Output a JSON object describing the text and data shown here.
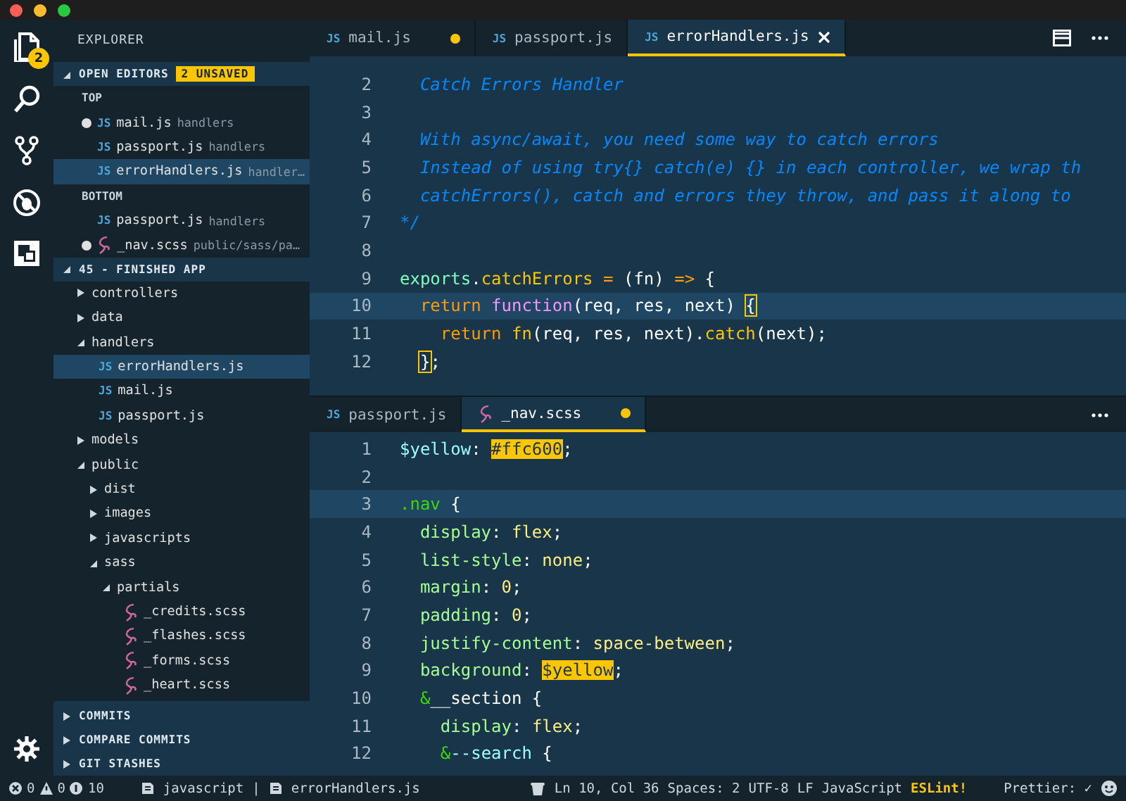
{
  "activity_bar": {
    "explorer_badge": "2"
  },
  "sidebar": {
    "title": "EXPLORER",
    "open_editors": {
      "title": "OPEN EDITORS",
      "badge": "2 UNSAVED",
      "expanded": true,
      "groups": [
        {
          "name": "TOP",
          "items": [
            {
              "kind": "js",
              "icon_text": "JS",
              "name": "mail.js",
              "path": "handlers",
              "dirty": true,
              "selected": false
            },
            {
              "kind": "js",
              "icon_text": "JS",
              "name": "passport.js",
              "path": "handlers",
              "dirty": false,
              "selected": false
            },
            {
              "kind": "js",
              "icon_text": "JS",
              "name": "errorHandlers.js",
              "path": "handler…",
              "dirty": false,
              "selected": true
            }
          ]
        },
        {
          "name": "BOTTOM",
          "items": [
            {
              "kind": "js",
              "icon_text": "JS",
              "name": "passport.js",
              "path": "handlers",
              "dirty": false,
              "selected": false
            },
            {
              "kind": "scss",
              "name": "_nav.scss",
              "path": "public/sass/pa…",
              "dirty": true,
              "selected": false
            }
          ]
        }
      ]
    },
    "project": {
      "title": "45 - FINISHED APP",
      "expanded": true,
      "tree": [
        {
          "kind": "folder",
          "name": "controllers",
          "expanded": false,
          "selected": false
        },
        {
          "kind": "folder",
          "name": "data",
          "expanded": false,
          "selected": false
        },
        {
          "kind": "folder",
          "name": "handlers",
          "expanded": true,
          "selected": false,
          "children": [
            {
              "kind": "js",
              "icon_text": "JS",
              "name": "errorHandlers.js",
              "selected": true
            },
            {
              "kind": "js",
              "icon_text": "JS",
              "name": "mail.js",
              "selected": false
            },
            {
              "kind": "js",
              "icon_text": "JS",
              "name": "passport.js",
              "selected": false
            }
          ]
        },
        {
          "kind": "folder",
          "name": "models",
          "expanded": false,
          "selected": false
        },
        {
          "kind": "folder",
          "name": "public",
          "expanded": true,
          "selected": false,
          "children": [
            {
              "kind": "folder",
              "name": "dist",
              "expanded": false,
              "selected": false
            },
            {
              "kind": "folder",
              "name": "images",
              "expanded": false,
              "selected": false
            },
            {
              "kind": "folder",
              "name": "javascripts",
              "expanded": false,
              "selected": false
            },
            {
              "kind": "folder",
              "name": "sass",
              "expanded": true,
              "selected": false,
              "children": [
                {
                  "kind": "folder",
                  "name": "partials",
                  "expanded": true,
                  "selected": false,
                  "children": [
                    {
                      "kind": "scss",
                      "name": "_credits.scss",
                      "selected": false
                    },
                    {
                      "kind": "scss",
                      "name": "_flashes.scss",
                      "selected": false
                    },
                    {
                      "kind": "scss",
                      "name": "_forms.scss",
                      "selected": false
                    },
                    {
                      "kind": "scss",
                      "name": "_heart.scss",
                      "selected": false
                    }
                  ]
                }
              ]
            }
          ]
        }
      ]
    },
    "panels": [
      {
        "title": "COMMITS",
        "expanded": false
      },
      {
        "title": "COMPARE COMMITS",
        "expanded": false
      },
      {
        "title": "GIT STASHES",
        "expanded": false
      }
    ]
  },
  "editors": [
    {
      "tabs": [
        {
          "kind": "js",
          "icon_text": "JS",
          "label": "mail.js",
          "dirty": true,
          "selected": false
        },
        {
          "kind": "js",
          "icon_text": "JS",
          "label": "passport.js",
          "dirty": false,
          "selected": false
        },
        {
          "kind": "js",
          "icon_text": "JS",
          "label": "errorHandlers.js",
          "dirty": false,
          "selected": true
        }
      ],
      "split_icon": true,
      "lines": [
        {
          "number": "2",
          "current": false,
          "segments": [
            {
              "text": "  Catch Errors Handler",
              "kind": "comment"
            }
          ]
        },
        {
          "number": "3",
          "current": false
        },
        {
          "number": "4",
          "current": false,
          "segments": [
            {
              "text": "  With async/await, you need some way to catch errors",
              "kind": "comment"
            }
          ]
        },
        {
          "number": "5",
          "current": false,
          "segments": [
            {
              "text": "  Instead of using try{} catch(e) {} in each controller, we wrap th",
              "kind": "comment"
            }
          ]
        },
        {
          "number": "6",
          "current": false,
          "segments": [
            {
              "text": "  catchErrors(), catch and errors they throw, and pass it along to",
              "kind": "comment"
            }
          ]
        },
        {
          "number": "7",
          "current": false,
          "segments": [
            {
              "text": "*/",
              "kind": "comment"
            }
          ]
        },
        {
          "number": "8",
          "current": false
        },
        {
          "number": "9",
          "current": false,
          "segments": [
            {
              "text": "exports",
              "kind": "object"
            },
            {
              "text": ".",
              "kind": "plain"
            },
            {
              "text": "catchErrors",
              "kind": "func"
            },
            {
              "text": " = ",
              "kind": "keyword"
            },
            {
              "text": "(fn) ",
              "kind": "plain"
            },
            {
              "text": "=>",
              "kind": "keyword"
            },
            {
              "text": " {",
              "kind": "plain"
            }
          ]
        },
        {
          "number": "10",
          "current": true,
          "segments": [
            {
              "text": "  return",
              "kind": "keyword"
            },
            {
              "text": " function",
              "kind": "storage"
            },
            {
              "text": "(req, res, next) ",
              "kind": "plain"
            },
            {
              "text": "{",
              "kind": "match"
            }
          ]
        },
        {
          "number": "11",
          "current": false,
          "segments": [
            {
              "text": "    return",
              "kind": "keyword"
            },
            {
              "text": " fn",
              "kind": "func"
            },
            {
              "text": "(req, res, next).",
              "kind": "plain"
            },
            {
              "text": "catch",
              "kind": "func"
            },
            {
              "text": "(next);",
              "kind": "plain"
            }
          ]
        },
        {
          "number": "12",
          "current": false,
          "segments": [
            {
              "text": "  }",
              "kind": "match"
            },
            {
              "text": ";",
              "kind": "plain"
            }
          ]
        }
      ]
    },
    {
      "tabs": [
        {
          "kind": "js",
          "icon_text": "JS",
          "label": "passport.js",
          "dirty": false,
          "selected": false
        },
        {
          "kind": "scss",
          "label": "_nav.scss",
          "dirty": true,
          "selected": true
        }
      ],
      "lines": [
        {
          "number": "1",
          "current": false,
          "segments": [
            {
              "text": "$yellow",
              "kind": "variable"
            },
            {
              "text": ": ",
              "kind": "plain"
            },
            {
              "text": "#ffc600",
              "kind": "highlight"
            },
            {
              "text": ";",
              "kind": "plain"
            }
          ]
        },
        {
          "number": "2",
          "current": false
        },
        {
          "number": "3",
          "current": true,
          "segments": [
            {
              "text": ".nav",
              "kind": "selector"
            },
            {
              "text": " {",
              "kind": "plain"
            }
          ]
        },
        {
          "number": "4",
          "current": false,
          "segments": [
            {
              "text": "  display",
              "kind": "prop"
            },
            {
              "text": ": ",
              "kind": "plain"
            },
            {
              "text": "flex",
              "kind": "value"
            },
            {
              "text": ";",
              "kind": "plain"
            }
          ]
        },
        {
          "number": "5",
          "current": false,
          "segments": [
            {
              "text": "  list-style",
              "kind": "prop"
            },
            {
              "text": ": ",
              "kind": "plain"
            },
            {
              "text": "none",
              "kind": "value"
            },
            {
              "text": ";",
              "kind": "plain"
            }
          ]
        },
        {
          "number": "6",
          "current": false,
          "segments": [
            {
              "text": "  margin",
              "kind": "prop"
            },
            {
              "text": ": ",
              "kind": "plain"
            },
            {
              "text": "0",
              "kind": "value"
            },
            {
              "text": ";",
              "kind": "plain"
            }
          ]
        },
        {
          "number": "7",
          "current": false,
          "segments": [
            {
              "text": "  padding",
              "kind": "prop"
            },
            {
              "text": ": ",
              "kind": "plain"
            },
            {
              "text": "0",
              "kind": "value"
            },
            {
              "text": ";",
              "kind": "plain"
            }
          ]
        },
        {
          "number": "8",
          "current": false,
          "segments": [
            {
              "text": "  justify-content",
              "kind": "prop"
            },
            {
              "text": ": ",
              "kind": "plain"
            },
            {
              "text": "space-between",
              "kind": "value"
            },
            {
              "text": ";",
              "kind": "plain"
            }
          ]
        },
        {
          "number": "9",
          "current": false,
          "segments": [
            {
              "text": "  background",
              "kind": "prop"
            },
            {
              "text": ": ",
              "kind": "plain"
            },
            {
              "text": "$yellow",
              "kind": "highlight"
            },
            {
              "text": ";",
              "kind": "plain"
            }
          ]
        },
        {
          "number": "10",
          "current": false,
          "segments": [
            {
              "text": "  &",
              "kind": "amp"
            },
            {
              "text": "__section {",
              "kind": "plain"
            }
          ]
        },
        {
          "number": "11",
          "current": false,
          "segments": [
            {
              "text": "    display",
              "kind": "prop"
            },
            {
              "text": ": ",
              "kind": "plain"
            },
            {
              "text": "flex",
              "kind": "value"
            },
            {
              "text": ";",
              "kind": "plain"
            }
          ]
        },
        {
          "number": "12",
          "current": false,
          "segments": [
            {
              "text": "    &",
              "kind": "amp"
            },
            {
              "text": "--search",
              "kind": "variable"
            },
            {
              "text": " {",
              "kind": "plain"
            }
          ]
        }
      ]
    }
  ],
  "status_bar": {
    "errors": "0",
    "warnings": "0",
    "infos": "10",
    "language_scope": "javascript",
    "separator": "|",
    "file": "errorHandlers.js",
    "position": "Ln 10, Col 36",
    "indent": "Spaces: 2",
    "encoding": "UTF-8",
    "eol": "LF",
    "language": "JavaScript",
    "eslint": "ESLint!",
    "prettier": "Prettier: ✓"
  }
}
